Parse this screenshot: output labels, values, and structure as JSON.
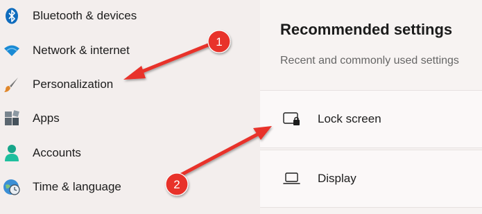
{
  "sidebar": {
    "items": [
      {
        "label": "Bluetooth & devices",
        "icon": "bluetooth-icon"
      },
      {
        "label": "Network & internet",
        "icon": "wifi-icon"
      },
      {
        "label": "Personalization",
        "icon": "paintbrush-icon"
      },
      {
        "label": "Apps",
        "icon": "apps-icon"
      },
      {
        "label": "Accounts",
        "icon": "person-icon"
      },
      {
        "label": "Time & language",
        "icon": "globe-clock-icon"
      }
    ]
  },
  "panel": {
    "title": "Recommended settings",
    "subtitle": "Recent and commonly used settings",
    "rows": [
      {
        "label": "Lock screen",
        "icon": "lock-screen-icon"
      },
      {
        "label": "Display",
        "icon": "laptop-icon"
      }
    ]
  },
  "annotations": [
    {
      "number": "1",
      "color": "#e8312a"
    },
    {
      "number": "2",
      "color": "#e8312a"
    }
  ],
  "colors": {
    "accent_blue": "#0f6cbd",
    "arrow_red": "#e8312a"
  }
}
